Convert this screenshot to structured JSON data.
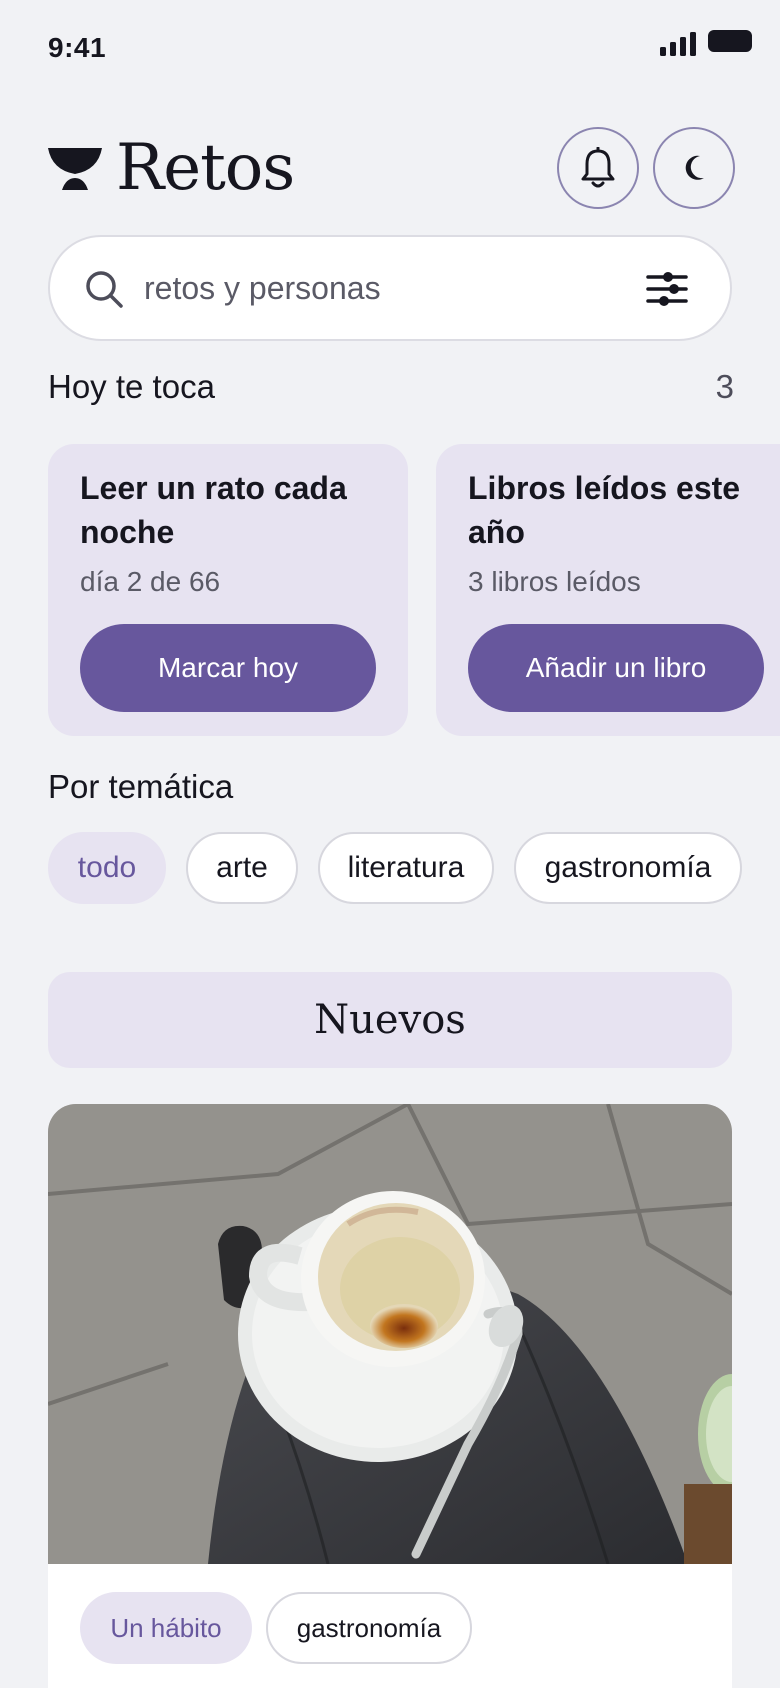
{
  "status_bar": {
    "time": "9:41"
  },
  "header": {
    "app_title": "Retos",
    "logo_icon": "cup-logo-icon",
    "notifications_icon": "bell-icon",
    "theme_icon": "moon-icon"
  },
  "search": {
    "placeholder": "retos y personas",
    "value": "",
    "icon": "search-icon",
    "filter_icon": "sliders-icon"
  },
  "today": {
    "title": "Hoy te toca",
    "count": "3",
    "cards": [
      {
        "title": "Leer un rato cada noche",
        "subtitle": "día 2 de 66",
        "button_label": "Marcar hoy"
      },
      {
        "title": "Libros leídos este año",
        "subtitle": "3 libros leídos",
        "button_label": "Añadir un libro"
      }
    ]
  },
  "topics": {
    "title": "Por temática",
    "selected": "todo",
    "chips": [
      "todo",
      "arte",
      "literatura",
      "gastronomía"
    ]
  },
  "news": {
    "title": "Nuevos",
    "feed": [
      {
        "image": "espresso-cup-photo",
        "tags": [
          "Un hábito",
          "gastronomía"
        ]
      }
    ]
  },
  "colors": {
    "background": "#f1f2f5",
    "accent": "#67579d",
    "accent_soft": "#e7e3f1",
    "text": "#16161f",
    "muted_text": "#5a5a66"
  }
}
